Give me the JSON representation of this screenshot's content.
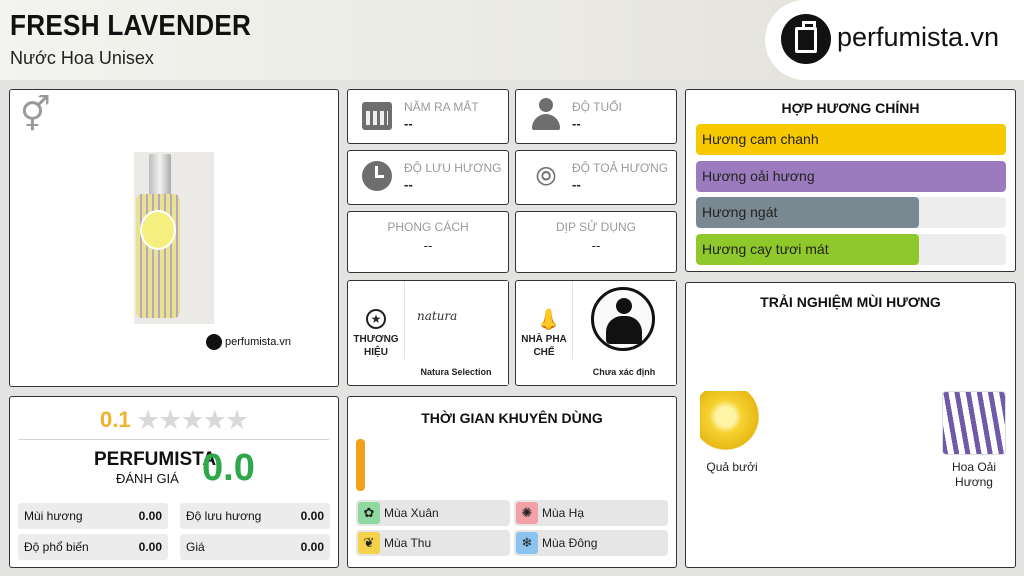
{
  "header": {
    "title": "FRESH LAVENDER",
    "subtitle": "Nước Hoa Unisex",
    "logo_text": "perfumista.vn"
  },
  "product": {
    "gender_icon": "unisex-gender-icon",
    "watermark": "perfumista.vn"
  },
  "info_cards": {
    "release_year": {
      "label": "NĂM RA MẮT",
      "value": "--"
    },
    "age": {
      "label": "ĐỘ TUỔI",
      "value": "--"
    },
    "longevity": {
      "label": "ĐỘ LƯU HƯƠNG",
      "value": "--"
    },
    "sillage": {
      "label": "ĐỘ TOẢ HƯƠNG",
      "value": "--"
    },
    "style": {
      "label": "PHONG CÁCH",
      "value": "--"
    },
    "occasion": {
      "label": "DỊP SỬ DỤNG",
      "value": "--"
    },
    "brand": {
      "caption": "THƯƠNG HIỆU",
      "logo_text": "natura",
      "name": "Natura Selection"
    },
    "perfumer": {
      "caption": "NHÀ PHA CHẾ",
      "name": "Chưa xác định"
    }
  },
  "accords": {
    "title": "HỢP HƯƠNG CHÍNH",
    "items": [
      {
        "label": "Hương cam chanh",
        "level": 1.0,
        "color": "#f8c800"
      },
      {
        "label": "Hương oải hương",
        "level": 1.0,
        "color": "#9b7bbd"
      },
      {
        "label": "Hương ngát",
        "level": 0.72,
        "color": "#7a8891"
      },
      {
        "label": "Hương cay tươi mát",
        "level": 0.72,
        "color": "#8ec82a"
      }
    ]
  },
  "experience": {
    "title": "TRẢI NGHIỆM MÙI HƯƠNG",
    "notes": [
      {
        "label": "Quả bưởi",
        "icon": "grapefruit-image"
      },
      {
        "label": "Hoa Oải Hương",
        "icon": "lavender-image"
      }
    ]
  },
  "rating": {
    "score": "0.1",
    "stars": "★★★★★",
    "star_fill": 0.02,
    "brand": "PERFUMISTA",
    "brand_sub": "ĐÁNH GIÁ",
    "brand_score": "0.0",
    "stats": [
      {
        "label": "Mùi hương",
        "value": "0.00"
      },
      {
        "label": "Độ lưu hương",
        "value": "0.00"
      },
      {
        "label": "Độ phổ biến",
        "value": "0.00"
      },
      {
        "label": "Giá",
        "value": "0.00"
      }
    ]
  },
  "recommended_time": {
    "title": "THỜI GIAN KHUYÊN DÙNG",
    "seasons": [
      {
        "label": "Mùa Xuân",
        "color": "#8fd9a0",
        "icon": "✿"
      },
      {
        "label": "Mùa Hạ",
        "color": "#f3a0a8",
        "icon": "✺"
      },
      {
        "label": "Mùa Thu",
        "color": "#f4d24a",
        "icon": "❦"
      },
      {
        "label": "Mùa Đông",
        "color": "#8cc4ef",
        "icon": "❄"
      }
    ]
  }
}
